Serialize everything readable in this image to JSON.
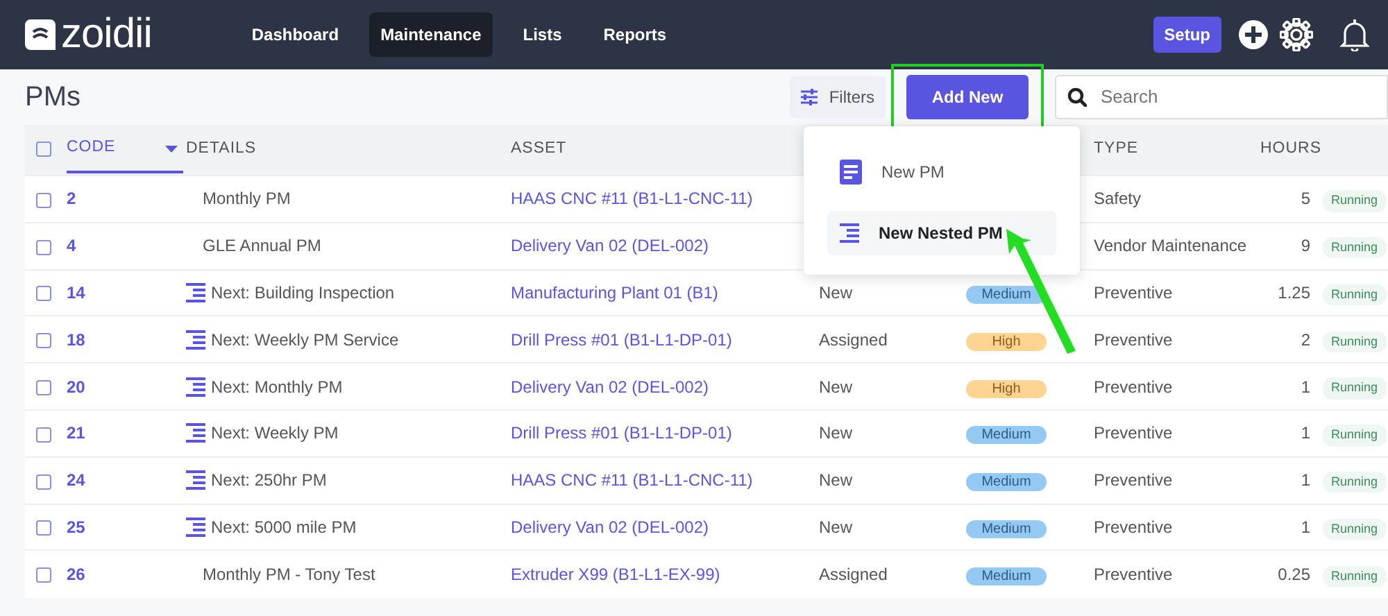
{
  "brand": "zoidii",
  "nav": [
    {
      "label": "Dashboard",
      "selected": false
    },
    {
      "label": "Maintenance",
      "selected": true
    },
    {
      "label": "Lists",
      "selected": false
    },
    {
      "label": "Reports",
      "selected": false
    }
  ],
  "setup_button": "Setup",
  "page_title": "PMs",
  "filters_button": "Filters",
  "add_new_button": "Add New",
  "search": {
    "placeholder": "Search"
  },
  "add_menu": [
    {
      "label": "New PM",
      "kind": "single",
      "selected": false
    },
    {
      "label": "New Nested PM",
      "kind": "nested",
      "selected": true
    }
  ],
  "table": {
    "all_checked": false,
    "columns": [
      {
        "label": "CODE",
        "sorted": true
      },
      {
        "label": "DETAILS",
        "sorted": false
      },
      {
        "label": "ASSET",
        "sorted": false
      },
      {
        "label": "TYPE",
        "sorted": false
      },
      {
        "label": "HOURS",
        "sorted": false
      }
    ],
    "rows": [
      {
        "checked": false,
        "code": "2",
        "nested": false,
        "details": "Monthly PM",
        "asset": "HAAS CNC #11 (B1-L1-CNC-11)",
        "type": "Safety",
        "hours": "5",
        "state": "Running"
      },
      {
        "checked": false,
        "code": "4",
        "nested": false,
        "details": "GLE Annual PM",
        "asset": "Delivery Van 02 (DEL-002)",
        "type": "Vendor Maintenance",
        "hours": "9",
        "state": "Running"
      },
      {
        "checked": false,
        "code": "14",
        "nested": true,
        "details": "Next: Building Inspection",
        "asset": "Manufacturing Plant 01 (B1)",
        "status": "New",
        "priority": "Medium",
        "type": "Preventive",
        "hours": "1.25",
        "state": "Running"
      },
      {
        "checked": false,
        "code": "18",
        "nested": true,
        "details": "Next: Weekly PM Service",
        "asset": "Drill Press #01 (B1-L1-DP-01)",
        "status": "Assigned",
        "priority": "High",
        "type": "Preventive",
        "hours": "2",
        "state": "Running"
      },
      {
        "checked": false,
        "code": "20",
        "nested": true,
        "details": "Next: Monthly PM",
        "asset": "Delivery Van 02 (DEL-002)",
        "status": "New",
        "priority": "High",
        "type": "Preventive",
        "hours": "1",
        "state": "Running"
      },
      {
        "checked": false,
        "code": "21",
        "nested": true,
        "details": "Next: Weekly PM",
        "asset": "Drill Press #01 (B1-L1-DP-01)",
        "status": "New",
        "priority": "Medium",
        "type": "Preventive",
        "hours": "1",
        "state": "Running"
      },
      {
        "checked": false,
        "code": "24",
        "nested": true,
        "details": "Next: 250hr PM",
        "asset": "HAAS CNC #11 (B1-L1-CNC-11)",
        "status": "New",
        "priority": "Medium",
        "type": "Preventive",
        "hours": "1",
        "state": "Running"
      },
      {
        "checked": false,
        "code": "25",
        "nested": true,
        "details": "Next: 5000 mile PM",
        "asset": "Delivery Van 02 (DEL-002)",
        "status": "New",
        "priority": "Medium",
        "type": "Preventive",
        "hours": "1",
        "state": "Running"
      },
      {
        "checked": false,
        "code": "26",
        "nested": false,
        "details": "Monthly PM - Tony Test",
        "asset": "Extruder X99 (B1-L1-EX-99)",
        "status": "Assigned",
        "priority": "Medium",
        "type": "Preventive",
        "hours": "0.25",
        "state": "Running"
      }
    ]
  }
}
